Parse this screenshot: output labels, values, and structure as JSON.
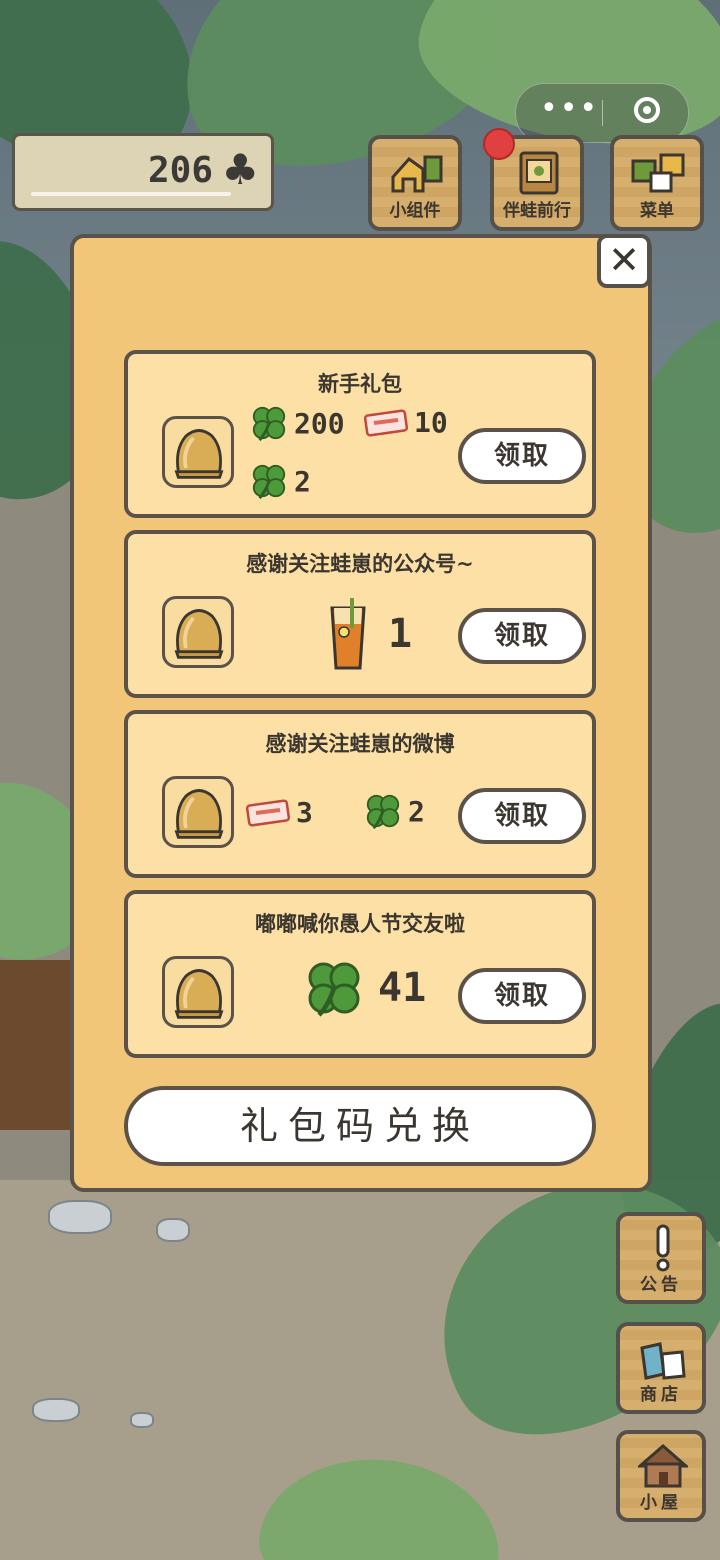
{
  "counter": {
    "clover_count": "206",
    "clover_symbol": "♣"
  },
  "top_buttons": [
    {
      "label": "小组件",
      "icon": "widget-icon"
    },
    {
      "label": "伴蛙前行",
      "icon": "journey-book-icon",
      "has_notification": true
    },
    {
      "label": "菜单",
      "icon": "menu-cards-icon"
    }
  ],
  "side_buttons": [
    {
      "label": "公告",
      "icon": "exclamation-icon"
    },
    {
      "label": "商店",
      "icon": "shop-bags-icon"
    },
    {
      "label": "小屋",
      "icon": "house-icon"
    }
  ],
  "dialog": {
    "close_symbol": "✕",
    "gifts": [
      {
        "title": "新手礼包",
        "rewards": [
          {
            "icon": "clover-icon",
            "qty": "200"
          },
          {
            "icon": "ticket-icon",
            "qty": "10"
          },
          {
            "icon": "four-leaf-clover-icon",
            "qty": "2"
          }
        ],
        "claim_label": "领取"
      },
      {
        "title": "感谢关注蛙崽的公众号~",
        "rewards": [
          {
            "icon": "iced-tea-icon",
            "qty": "1"
          }
        ],
        "claim_label": "领取"
      },
      {
        "title": "感谢关注蛙崽的微博",
        "rewards": [
          {
            "icon": "ticket-icon",
            "qty": "3"
          },
          {
            "icon": "four-leaf-clover-icon",
            "qty": "2"
          }
        ],
        "claim_label": "领取"
      },
      {
        "title": "嘟嘟喊你愚人节交友啦",
        "rewards": [
          {
            "icon": "clover-icon",
            "qty": "41"
          }
        ],
        "claim_label": "领取"
      }
    ],
    "redeem_label": "礼包码兑换"
  },
  "colors": {
    "panel": "#f1c678",
    "card": "#fde0a6",
    "outline": "#5b5349",
    "clover": "#4e9a3a"
  }
}
